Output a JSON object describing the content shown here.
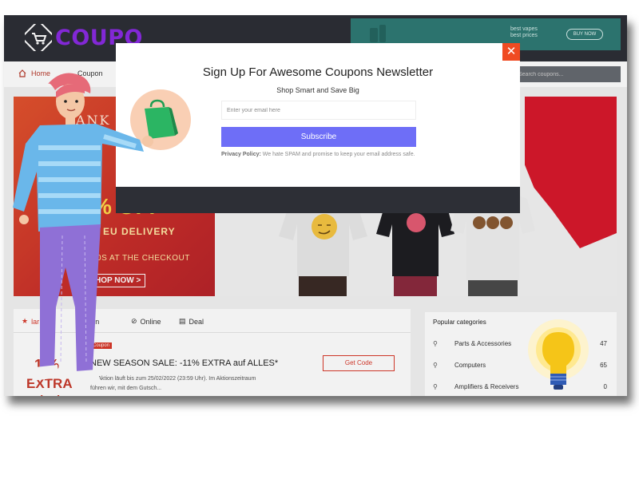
{
  "site": {
    "logo_text": "COUPO",
    "ad_text": "best vapes\nbest prices",
    "ad_button": "BUY NOW"
  },
  "breadcrumb": {
    "home": "Home",
    "current": "Coupon"
  },
  "search": {
    "placeholder": "Search coupons..."
  },
  "hero": {
    "thank": "ANK H",
    "deal": "% OFF",
    "delivery": "& EU DELIVERY",
    "checkout": "40S AT THE CHECKOUT",
    "shop_now": "HOP NOW >"
  },
  "tabs": [
    {
      "label": "lar",
      "icon": "star-icon"
    },
    {
      "label": "upon",
      "icon": "tag-icon"
    },
    {
      "label": "Online",
      "icon": "link-icon"
    },
    {
      "label": "Deal",
      "icon": "deal-icon"
    }
  ],
  "coupon": {
    "pct": "1 %",
    "extra": "EXTRA",
    "extra2": "reduziert",
    "badge": "Coupon",
    "title": "NEW SEASON SALE: -11% EXTRA auf ALLES*",
    "desc": "ne Aktion läuft bis zum 25/02/2022 (23:59 Uhr). Im Aktionszeitraum\nführen wir, mit dem Gutsch...",
    "get_code": "Get Code"
  },
  "categories": {
    "title": "Popular categories",
    "items": [
      {
        "label": "Parts & Accessories",
        "count": "47"
      },
      {
        "label": "Computers",
        "count": "65"
      },
      {
        "label": "Amplifiers & Receivers",
        "count": "0"
      }
    ]
  },
  "modal": {
    "title": "Sign Up For Awesome Coupons Newsletter",
    "subtitle": "Shop Smart and Save Big",
    "email_placeholder": "Enter your email here",
    "subscribe_label": "Subscribe",
    "privacy_label": "Privacy Policy:",
    "privacy_text": "We hate SPAM and promise to keep your email address safe.",
    "close_symbol": "✕"
  },
  "colors": {
    "accent": "#6e6ef7",
    "close": "#f04b22",
    "header": "#2d2f36",
    "brand": "#8a2be2",
    "sale_red": "#d9392b"
  }
}
